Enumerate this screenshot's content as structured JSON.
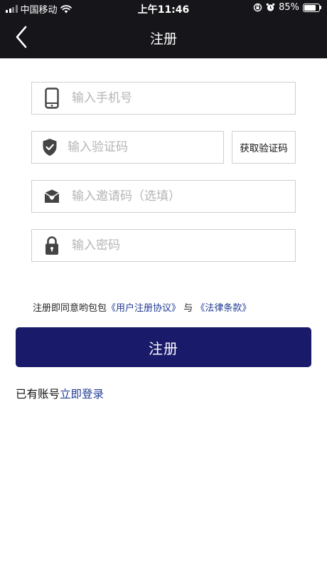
{
  "status_bar": {
    "carrier": "中国移动",
    "time": "上午11:46",
    "battery": "85%",
    "icons": [
      "signal-icon",
      "wifi-icon",
      "rotation-lock-icon",
      "alarm-icon",
      "battery-icon"
    ]
  },
  "nav": {
    "title": "注册",
    "back_icon": "chevron-left-icon"
  },
  "form": {
    "phone_placeholder": "输入手机号",
    "code_placeholder": "输入验证码",
    "invite_placeholder": "输入邀请码（选填）",
    "password_placeholder": "输入密码",
    "get_code_label": "获取验证码"
  },
  "agreement": {
    "prefix": "注册即同意哟包包",
    "user_agreement": "《用户注册协议》",
    "connector": "与",
    "legal_terms": "《法律条款》"
  },
  "submit_label": "注册",
  "login": {
    "prompt": "已有账号",
    "link": "立即登录"
  },
  "colors": {
    "header_bg": "#16161a",
    "button_bg": "#1a1a6b",
    "link": "#1f3a93",
    "icon": "#444444"
  }
}
